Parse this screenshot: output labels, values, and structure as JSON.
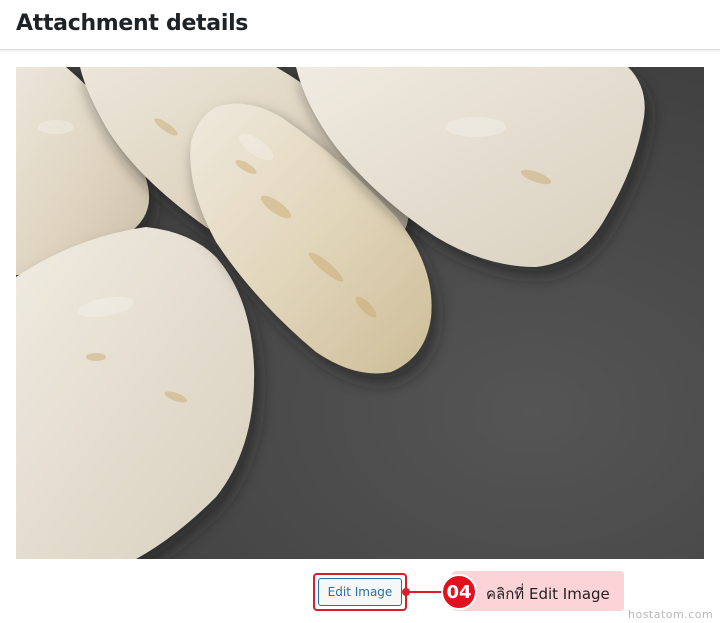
{
  "header": {
    "title": "Attachment details"
  },
  "preview": {
    "alt": "attachment-image-stones",
    "background_color": "#4a4a4a"
  },
  "actions": {
    "edit_image_label": "Edit Image"
  },
  "annotation": {
    "step_number": "04",
    "text": "คลิกที่ Edit Image",
    "color": "#e3101e"
  },
  "watermark": {
    "text": "hostatom.com"
  },
  "colors": {
    "accent": "#2271b1",
    "highlight": "#d91e2b",
    "callout_bg": "#fcd4d7"
  }
}
